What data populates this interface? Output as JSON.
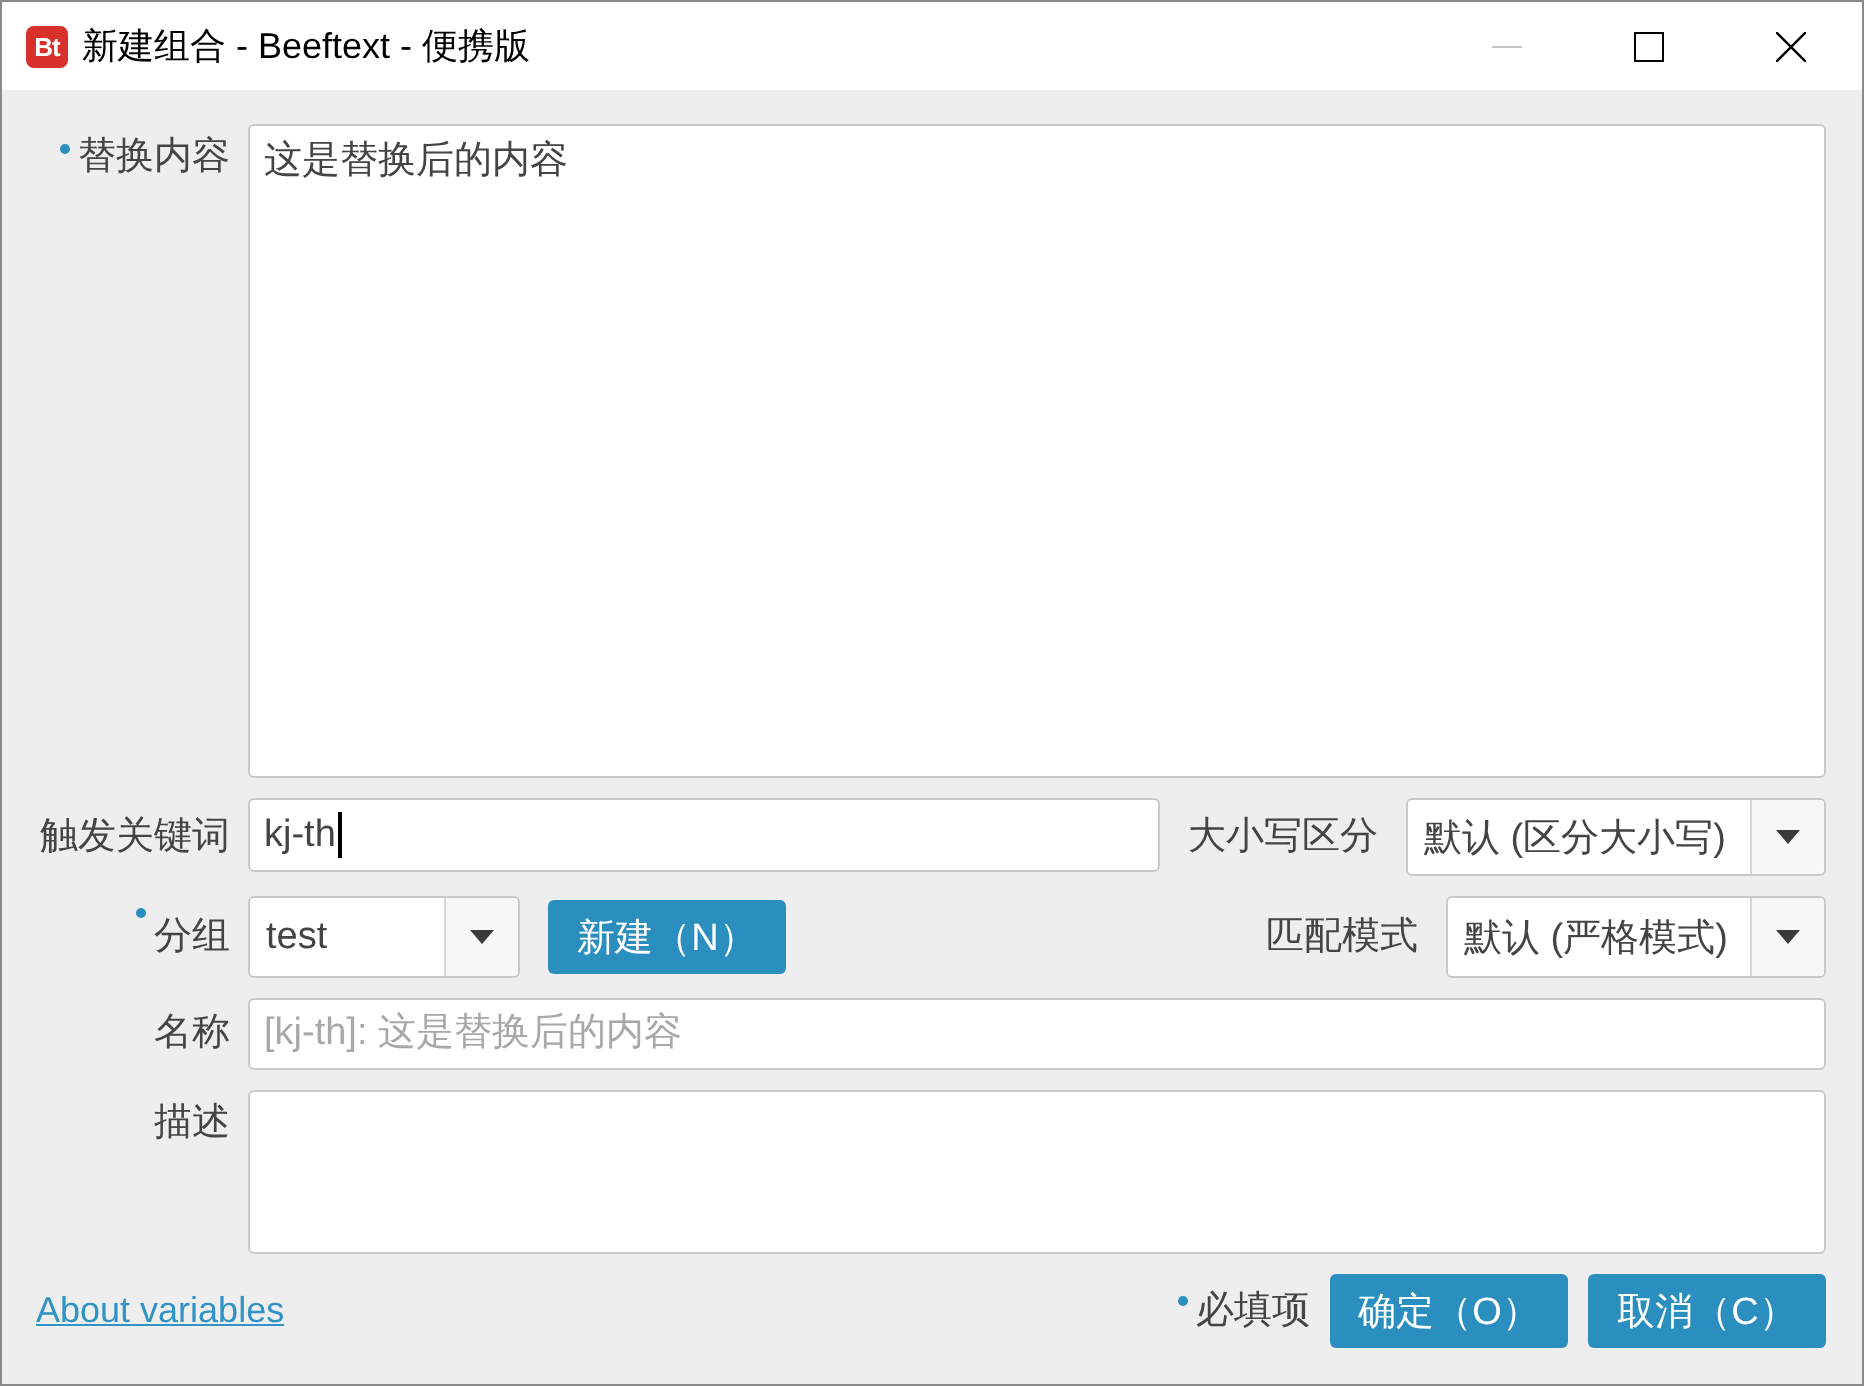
{
  "window": {
    "logo": "Bt",
    "title": "新建组合 - Beeftext - 便携版",
    "controls": [
      {
        "kind": "minimize",
        "disabled": true
      },
      {
        "kind": "maximize",
        "disabled": false
      },
      {
        "kind": "close",
        "disabled": false
      }
    ]
  },
  "form": {
    "content": {
      "label": "替换内容",
      "required": true,
      "value": "这是替换后的内容"
    },
    "keyword": {
      "label": "触发关键词",
      "required": false,
      "value": "kj-th",
      "focused": true
    },
    "case": {
      "label": "大小写区分",
      "value": "默认 (区分大小写)"
    },
    "group": {
      "label": "分组",
      "required": true,
      "value": "test",
      "new_button": "新建（N）"
    },
    "match": {
      "label": "匹配模式",
      "value": "默认 (严格模式)"
    },
    "name": {
      "label": "名称",
      "required": false,
      "placeholder": "[kj-th]: 这是替换后的内容"
    },
    "description": {
      "label": "描述",
      "required": false
    }
  },
  "footer": {
    "link": "About variables",
    "required_note": "必填项",
    "buttons": [
      "确定（O）",
      "取消（C）"
    ]
  }
}
